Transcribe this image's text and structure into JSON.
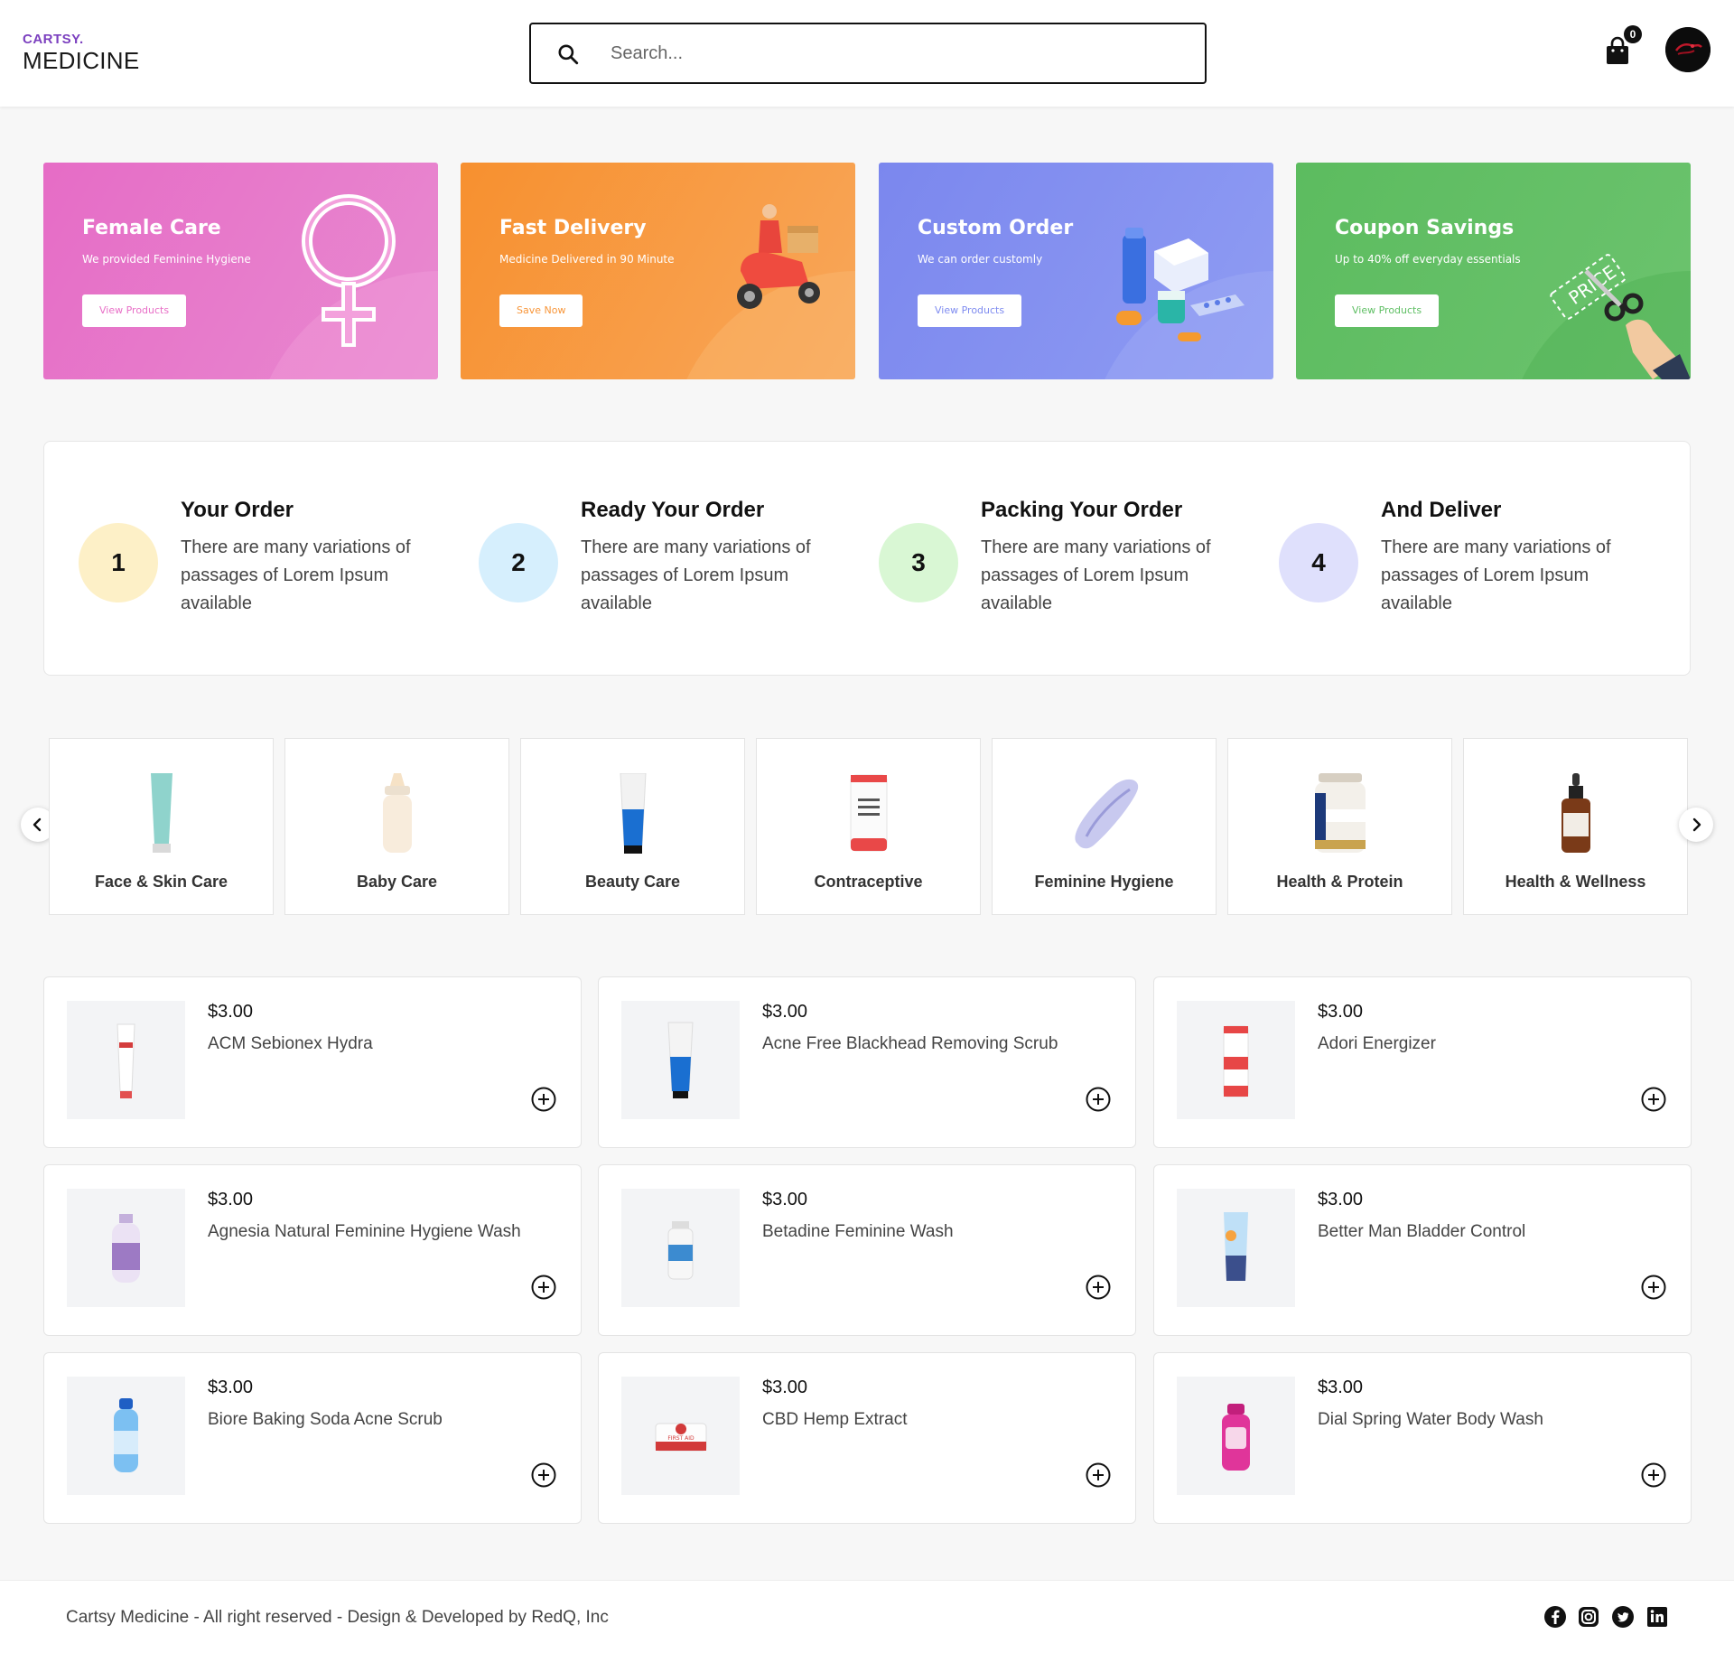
{
  "header": {
    "brand_small": "CARTSY.",
    "brand_large": "MEDICINE",
    "search_placeholder": "Search...",
    "cart_count": "0"
  },
  "promos": [
    {
      "title": "Female Care",
      "subtitle": "We provided Feminine Hygiene",
      "button": "View Products",
      "color": "#e86fc7",
      "button_color": "#e86fc7"
    },
    {
      "title": "Fast Delivery",
      "subtitle": "Medicine Delivered in 90 Minute",
      "button": "Save Now",
      "color": "#f8963a",
      "button_color": "#f8963a"
    },
    {
      "title": "Custom Order",
      "subtitle": "We can order customly",
      "button": "View Products",
      "color": "#7f8cf0",
      "button_color": "#7f8cf0"
    },
    {
      "title": "Coupon Savings",
      "subtitle": "Up to 40% off everyday essentials",
      "button": "View Products",
      "color": "#5fbf64",
      "button_color": "#5fbf64"
    }
  ],
  "steps": [
    {
      "number": "1",
      "title": "Your Order",
      "text": "There are many variations of passages of Lorem Ipsum available",
      "color": "#fdf0c7"
    },
    {
      "number": "2",
      "title": "Ready Your Order",
      "text": "There are many variations of passages of Lorem Ipsum available",
      "color": "#d6effd"
    },
    {
      "number": "3",
      "title": "Packing Your Order",
      "text": "There are many variations of passages of Lorem Ipsum available",
      "color": "#d9f7d4"
    },
    {
      "number": "4",
      "title": "And Deliver",
      "text": "There are many variations of passages of Lorem Ipsum available",
      "color": "#dfe0fc"
    }
  ],
  "categories": [
    {
      "label": "Face & Skin Care",
      "icon": "skin-care-tube-icon"
    },
    {
      "label": "Baby Care",
      "icon": "baby-bottle-icon"
    },
    {
      "label": "Beauty Care",
      "icon": "beauty-tube-icon"
    },
    {
      "label": "Contraceptive",
      "icon": "contraceptive-bottle-icon"
    },
    {
      "label": "Feminine Hygiene",
      "icon": "sanitary-pad-icon"
    },
    {
      "label": "Health & Protein",
      "icon": "protein-jar-icon"
    },
    {
      "label": "Health & Wellness",
      "icon": "dropper-bottle-icon"
    }
  ],
  "products": [
    {
      "price": "$3.00",
      "name": "ACM Sebionex Hydra"
    },
    {
      "price": "$3.00",
      "name": "Acne Free Blackhead Removing Scrub"
    },
    {
      "price": "$3.00",
      "name": "Adori Energizer"
    },
    {
      "price": "$3.00",
      "name": "Agnesia Natural Feminine Hygiene Wash"
    },
    {
      "price": "$3.00",
      "name": "Betadine Feminine Wash"
    },
    {
      "price": "$3.00",
      "name": "Better Man Bladder Control"
    },
    {
      "price": "$3.00",
      "name": "Biore Baking Soda Acne Scrub"
    },
    {
      "price": "$3.00",
      "name": "CBD Hemp Extract"
    },
    {
      "price": "$3.00",
      "name": "Dial Spring Water Body Wash"
    }
  ],
  "product_art_text": {
    "first_aid": "FIRST AID",
    "coupon_tag": "PRICE"
  },
  "footer": {
    "copyright": "Cartsy Medicine - All right reserved - Design & Developed by RedQ, Inc",
    "social": [
      "facebook-icon",
      "instagram-icon",
      "twitter-icon",
      "linkedin-icon"
    ]
  }
}
